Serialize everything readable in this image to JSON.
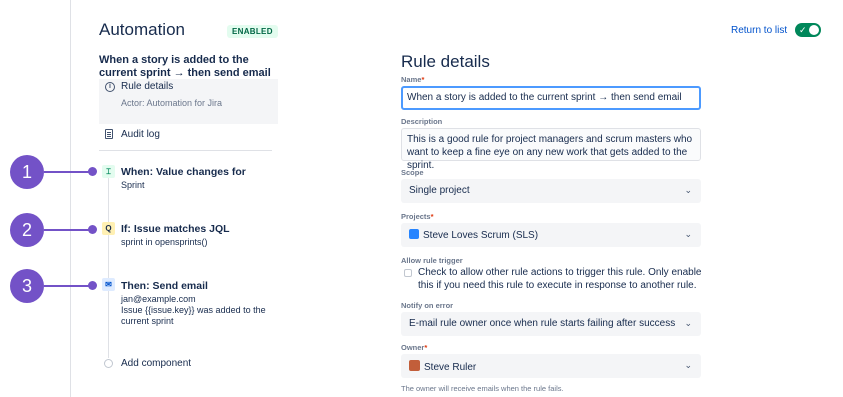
{
  "header": {
    "title": "Automation",
    "badge": "ENABLED",
    "return_link": "Return to list",
    "toggle_check": "✓"
  },
  "sidebar": {
    "rule_name": "When a story is added to the current sprint → then send email",
    "rule_details_label": "Rule details",
    "actor_text": "Actor: Automation for Jira",
    "audit_log_label": "Audit log",
    "components": [
      {
        "icon": "trigger-icon",
        "glyph": "⌶",
        "title": "When: Value changes for",
        "subtitle": "Sprint"
      },
      {
        "icon": "search-icon",
        "glyph": "Q",
        "title": "If: Issue matches JQL",
        "subtitle": "sprint in opensprints()"
      },
      {
        "icon": "email-icon",
        "glyph": "✉",
        "title": "Then: Send email",
        "subtitle_lines": [
          "jan@example.com",
          "Issue {{issue.key}} was added to the current sprint"
        ]
      }
    ],
    "add_component_label": "Add component"
  },
  "callouts": [
    "1",
    "2",
    "3"
  ],
  "details": {
    "title": "Rule details",
    "name_label": "Name",
    "name_value": "When a story is added to the current sprint → then send email",
    "description_label": "Description",
    "description_value": "This is a good rule for project managers and scrum masters who want to keep a fine eye on any new work that gets added to the sprint.",
    "scope_label": "Scope",
    "scope_value": "Single project",
    "projects_label": "Projects",
    "projects_value": "Steve Loves Scrum (SLS)",
    "allow_trigger_label": "Allow rule trigger",
    "allow_trigger_text": "Check to allow other rule actions to trigger this rule. Only enable this if you need this rule to execute in response to another rule.",
    "notify_label": "Notify on error",
    "notify_value": "E-mail rule owner once when rule starts failing after success",
    "owner_label": "Owner",
    "owner_value": "Steve Ruler",
    "owner_note": "The owner will receive emails when the rule fails.",
    "required_mark": "*",
    "chevron": "⌄"
  },
  "colors": {
    "accent": "#7352c7",
    "link": "#0052cc",
    "toggle_on": "#00875a",
    "badge_bg": "#e3fcef",
    "badge_text": "#006644"
  }
}
